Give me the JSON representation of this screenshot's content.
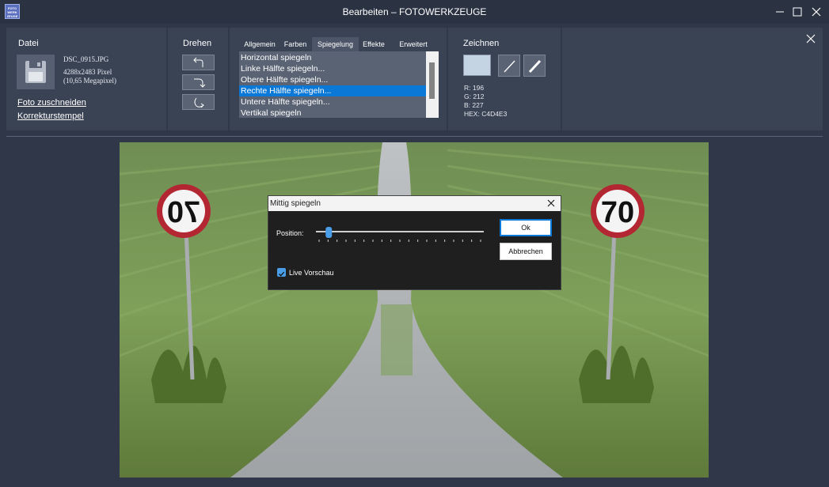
{
  "window": {
    "title": "Bearbeiten – FOTOWERKZEUGE",
    "app_icon_text": [
      "FOTO",
      "WERK",
      "ZEUGE"
    ],
    "controls": [
      "minimize-icon",
      "maximize-icon",
      "close-icon"
    ]
  },
  "ribbon": {
    "datei": {
      "title": "Datei",
      "filename": "DSC_0915.JPG",
      "dimensions": "4288x2483 Pixel",
      "megapixel": "(10,65 Megapixel)",
      "links": [
        "Foto zuschneiden",
        "Korrekturstempel"
      ]
    },
    "drehen": {
      "title": "Drehen",
      "buttons": [
        "rotate-left-icon",
        "rotate-right-icon",
        "rotate-flip-icon"
      ]
    },
    "tabs": [
      "Allgemein",
      "Farben",
      "Spiegelung",
      "Effekte",
      "Erweitert"
    ],
    "active_tab": "Spiegelung",
    "list_items": [
      "Horizontal spiegeln",
      "Linke Hälfte spiegeln...",
      "Obere Hälfte spiegeln...",
      "Rechte Hälfte spiegeln...",
      "Untere Hälfte spiegeln...",
      "Vertikal spiegeln"
    ],
    "selected_item": "Rechte Hälfte spiegeln...",
    "zeichnen": {
      "title": "Zeichnen",
      "color_hex_value": "#c4d4e3",
      "r": "R: 196",
      "g": "G: 212",
      "b": "B: 227",
      "hex": "HEX: C4D4E3"
    }
  },
  "dialog": {
    "title": "Mittig spiegeln",
    "position_label": "Position:",
    "slider_value": 0.06,
    "ok_label": "Ok",
    "cancel_label": "Abbrechen",
    "live_preview_label": "Live Vorschau",
    "live_preview_checked": true
  },
  "photo": {
    "sign_left": "70",
    "sign_right": "70"
  }
}
